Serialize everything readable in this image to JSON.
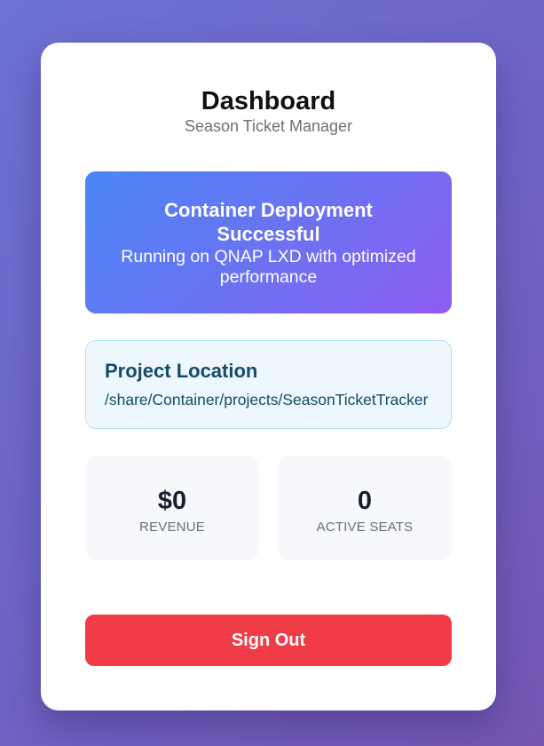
{
  "header": {
    "title": "Dashboard",
    "subtitle": "Season Ticket Manager"
  },
  "banner": {
    "title": "Container Deployment Successful",
    "text": "Running on QNAP LXD with optimized performance"
  },
  "project_location": {
    "title": "Project Location",
    "path": "/share/Container/projects/SeasonTicketTracker"
  },
  "stats": [
    {
      "value": "$0",
      "label": "REVENUE"
    },
    {
      "value": "0",
      "label": "ACTIVE SEATS"
    }
  ],
  "actions": {
    "sign_out_label": "Sign Out"
  },
  "colors": {
    "sign_out": "#ef3c47",
    "banner_start": "#4a86f5",
    "banner_end": "#8d5cf0",
    "location_text": "#134b68"
  }
}
